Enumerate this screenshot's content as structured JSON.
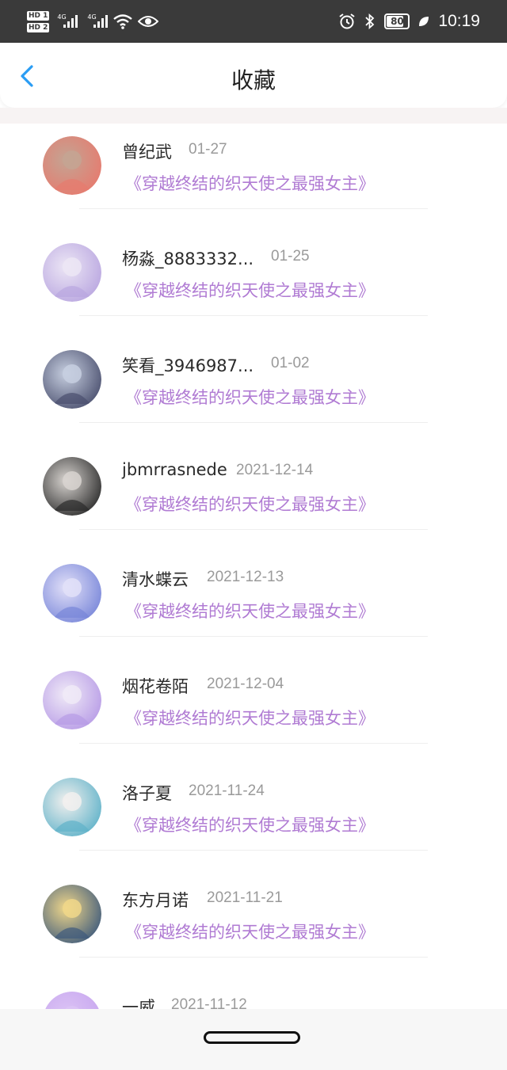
{
  "status_bar": {
    "hd1": "HD 1",
    "hd2": "HD 2",
    "net1": "4G",
    "net2": "4G",
    "battery": "80",
    "time": "10:19",
    "icons": [
      "hd-icon",
      "signal-icon",
      "wifi-icon",
      "eye-icon",
      "alarm-icon",
      "bluetooth-icon",
      "battery-icon",
      "leaf-icon"
    ]
  },
  "header": {
    "title": "收藏",
    "back_icon": "chevron-left-icon",
    "accent": "#2a9df4"
  },
  "favorites": [
    {
      "name": "曾纪武",
      "date": "01-27",
      "book": "《穿越终结的织天使之最强女主》",
      "avatar_colors": [
        "#e77a6e",
        "#c4a493"
      ]
    },
    {
      "name": "杨淼_8883332...",
      "date": "01-25",
      "book": "《穿越终结的织天使之最强女主》",
      "avatar_colors": [
        "#b9a6e0",
        "#ece6f5"
      ]
    },
    {
      "name": "笑看_3946987...",
      "date": "01-02",
      "book": "《穿越终结的织天使之最强女主》",
      "avatar_colors": [
        "#4a4f6e",
        "#c7cfe0"
      ]
    },
    {
      "name": "jbmrrasnede",
      "date": "2021-12-14",
      "book": "《穿越终结的织天使之最强女主》",
      "avatar_colors": [
        "#2b2b2b",
        "#d8d4d0"
      ]
    },
    {
      "name": "清水蝶云",
      "date": "2021-12-13",
      "book": "《穿越终结的织天使之最强女主》",
      "avatar_colors": [
        "#7886d9",
        "#e2e0f8"
      ]
    },
    {
      "name": "烟花卷陌",
      "date": "2021-12-04",
      "book": "《穿越终结的织天使之最强女主》",
      "avatar_colors": [
        "#b79be6",
        "#f0eaf7"
      ]
    },
    {
      "name": "洛子夏",
      "date": "2021-11-24",
      "book": "《穿越终结的织天使之最强女主》",
      "avatar_colors": [
        "#5fb2c9",
        "#f2f0ee"
      ]
    },
    {
      "name": "东方月诺",
      "date": "2021-11-21",
      "book": "《穿越终结的织天使之最强女主》",
      "avatar_colors": [
        "#3e5a7c",
        "#f0d78a"
      ]
    },
    {
      "name": "一威",
      "date": "2021-11-12",
      "book": "",
      "avatar_colors": [
        "#c7a6ef",
        "#dcc4f5"
      ]
    }
  ],
  "colors": {
    "status_bar_bg": "#3a3a3a",
    "name_text": "#2a2a2a",
    "date_text": "#9a9a9a",
    "book_text": "#b07bd3"
  }
}
